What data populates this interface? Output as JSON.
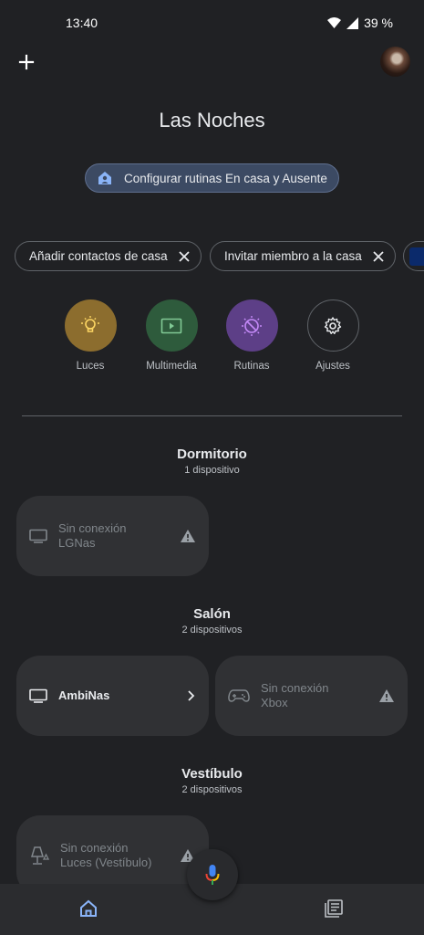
{
  "status": {
    "time": "13:40",
    "battery": "39 %"
  },
  "header": {
    "home_name": "Las Noches"
  },
  "routine_chip": {
    "label": "Configurar rutinas En casa y Ausente"
  },
  "suggestion_chips": [
    {
      "label": "Añadir contactos de casa"
    },
    {
      "label": "Invitar miembro a la casa"
    }
  ],
  "shortcuts": [
    {
      "label": "Luces",
      "icon": "lightbulb-icon",
      "color": "#8c6d2e"
    },
    {
      "label": "Multimedia",
      "icon": "media-icon",
      "color": "#2e5b3c"
    },
    {
      "label": "Rutinas",
      "icon": "routines-icon",
      "color": "#5d3f87"
    },
    {
      "label": "Ajustes",
      "icon": "gear-icon",
      "color": "#202124"
    }
  ],
  "rooms": [
    {
      "name": "Dormitorio",
      "count": "1 dispositivo",
      "devices": [
        {
          "status": "Sin conexión",
          "name": "LGNas",
          "icon": "tv-icon"
        }
      ]
    },
    {
      "name": "Salón",
      "count": "2 dispositivos",
      "devices": [
        {
          "name": "AmbiNas",
          "icon": "tv-icon"
        },
        {
          "status": "Sin conexión",
          "name": "Xbox",
          "icon": "gamepad-icon"
        }
      ]
    },
    {
      "name": "Vestíbulo",
      "count": "2 dispositivos",
      "devices": [
        {
          "status": "Sin conexión",
          "name": "Luces (Vestíbulo)",
          "icon": "lamp-icon"
        }
      ]
    }
  ]
}
